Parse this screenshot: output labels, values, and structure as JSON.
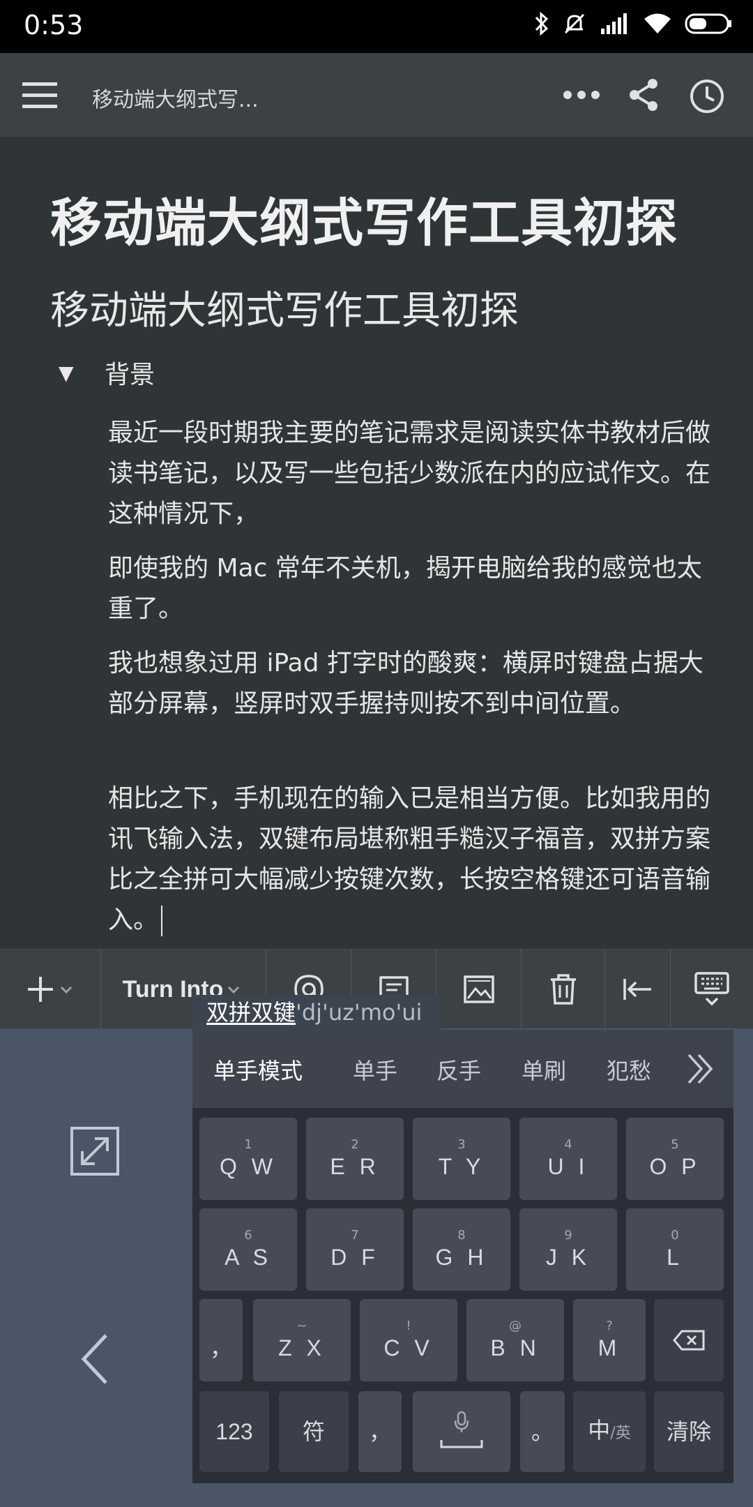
{
  "status_bar": {
    "time": "0:53"
  },
  "app_bar": {
    "title": "移动端大纲式写..."
  },
  "document": {
    "title": "移动端大纲式写作工具初探",
    "heading": "移动端大纲式写作工具初探",
    "toggle_label": "背景",
    "paragraphs": [
      "最近一段时期我主要的笔记需求是阅读实体书教材后做读书笔记，以及写一些包括少数派在内的应试作文。在这种情况下，",
      "即使我的 Mac 常年不关机，揭开电脑给我的感觉也太重了。",
      "我也想象过用 iPad 打字时的酸爽：横屏时键盘占据大部分屏幕，竖屏时双手握持则按不到中间位置。",
      "相比之下，手机现在的输入已是相当方便。比如我用的讯飞输入法，双键布局堪称粗手糙汉子福音，双拼方案比之全拼可大幅减少按键次数，长按空格键还可语音输入。"
    ]
  },
  "toolbar": {
    "turn_into": "Turn Into"
  },
  "ime": {
    "composition_converted": "双拼双键",
    "composition_pinyin": "'dj'uz'mo'ui",
    "candidates": [
      "单手模式",
      "单手",
      "反手",
      "单刷",
      "犯愁"
    ],
    "rows": [
      [
        {
          "sup": "1",
          "main": "Q W"
        },
        {
          "sup": "2",
          "main": "E R"
        },
        {
          "sup": "3",
          "main": "T Y"
        },
        {
          "sup": "4",
          "main": "U I"
        },
        {
          "sup": "5",
          "main": "O P"
        }
      ],
      [
        {
          "sup": "6",
          "main": "A S"
        },
        {
          "sup": "7",
          "main": "D F"
        },
        {
          "sup": "8",
          "main": "G H"
        },
        {
          "sup": "9",
          "main": "J K"
        },
        {
          "sup": "0",
          "main": "L"
        }
      ],
      [
        {
          "sup": "",
          "main": "，"
        },
        {
          "sup": "~",
          "main": "Z X"
        },
        {
          "sup": "!",
          "main": "C V"
        },
        {
          "sup": "@",
          "main": "B N"
        },
        {
          "sup": "?",
          "main": "M"
        }
      ]
    ],
    "bottom_row": {
      "num": "123",
      "symbol": "符",
      "comma": "，",
      "period": "。",
      "lang_main": "中",
      "lang_sub": "/英",
      "clear": "清除"
    }
  },
  "colors": {
    "doc_bg": "#2f3437",
    "appbar_bg": "#3b4145",
    "keyboard_bg": "#4a5567",
    "key_bg": "#484b57"
  }
}
